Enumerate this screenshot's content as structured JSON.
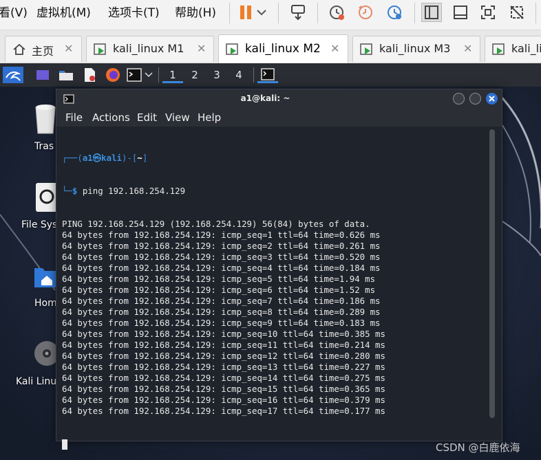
{
  "vmware": {
    "menu": [
      "看(V)",
      "虚拟机(M)",
      "选项卡(T)",
      "帮助(H)"
    ],
    "tabs": [
      {
        "label": "主页"
      },
      {
        "label": "kali_linux M1"
      },
      {
        "label": "kali_linux M2"
      },
      {
        "label": "kali_linux M3"
      },
      {
        "label": "kali_lin"
      }
    ],
    "tab_close": "✕"
  },
  "kali_panel": {
    "workspaces": [
      "1",
      "2",
      "3",
      "4"
    ]
  },
  "desktop": {
    "icons": [
      {
        "label": "Tras"
      },
      {
        "label": "File Sys"
      },
      {
        "label": "Hom"
      },
      {
        "label": "Kali Linux"
      }
    ]
  },
  "terminal": {
    "title": "a1@kali: ~",
    "menu": [
      "File",
      "Actions",
      "Edit",
      "View",
      "Help"
    ],
    "prompt_user": "a1",
    "prompt_host": "kali",
    "prompt_dir": "~",
    "command": "ping 192.168.254.129",
    "output": [
      "PING 192.168.254.129 (192.168.254.129) 56(84) bytes of data.",
      "64 bytes from 192.168.254.129: icmp_seq=1 ttl=64 time=0.626 ms",
      "64 bytes from 192.168.254.129: icmp_seq=2 ttl=64 time=0.261 ms",
      "64 bytes from 192.168.254.129: icmp_seq=3 ttl=64 time=0.520 ms",
      "64 bytes from 192.168.254.129: icmp_seq=4 ttl=64 time=0.184 ms",
      "64 bytes from 192.168.254.129: icmp_seq=5 ttl=64 time=1.94 ms",
      "64 bytes from 192.168.254.129: icmp_seq=6 ttl=64 time=1.52 ms",
      "64 bytes from 192.168.254.129: icmp_seq=7 ttl=64 time=0.186 ms",
      "64 bytes from 192.168.254.129: icmp_seq=8 ttl=64 time=0.289 ms",
      "64 bytes from 192.168.254.129: icmp_seq=9 ttl=64 time=0.183 ms",
      "64 bytes from 192.168.254.129: icmp_seq=10 ttl=64 time=0.385 ms",
      "64 bytes from 192.168.254.129: icmp_seq=11 ttl=64 time=0.214 ms",
      "64 bytes from 192.168.254.129: icmp_seq=12 ttl=64 time=0.280 ms",
      "64 bytes from 192.168.254.129: icmp_seq=13 ttl=64 time=0.227 ms",
      "64 bytes from 192.168.254.129: icmp_seq=14 ttl=64 time=0.275 ms",
      "64 bytes from 192.168.254.129: icmp_seq=15 ttl=64 time=0.365 ms",
      "64 bytes from 192.168.254.129: icmp_seq=16 ttl=64 time=0.379 ms",
      "64 bytes from 192.168.254.129: icmp_seq=17 ttl=64 time=0.177 ms"
    ]
  },
  "watermark": "CSDN @白鹿依海",
  "colors": {
    "accent": "#3b8de6",
    "prompt_blue": "#3a8fe0",
    "close_button": "#2f6fd1",
    "pause_orange": "#f07d2a"
  }
}
